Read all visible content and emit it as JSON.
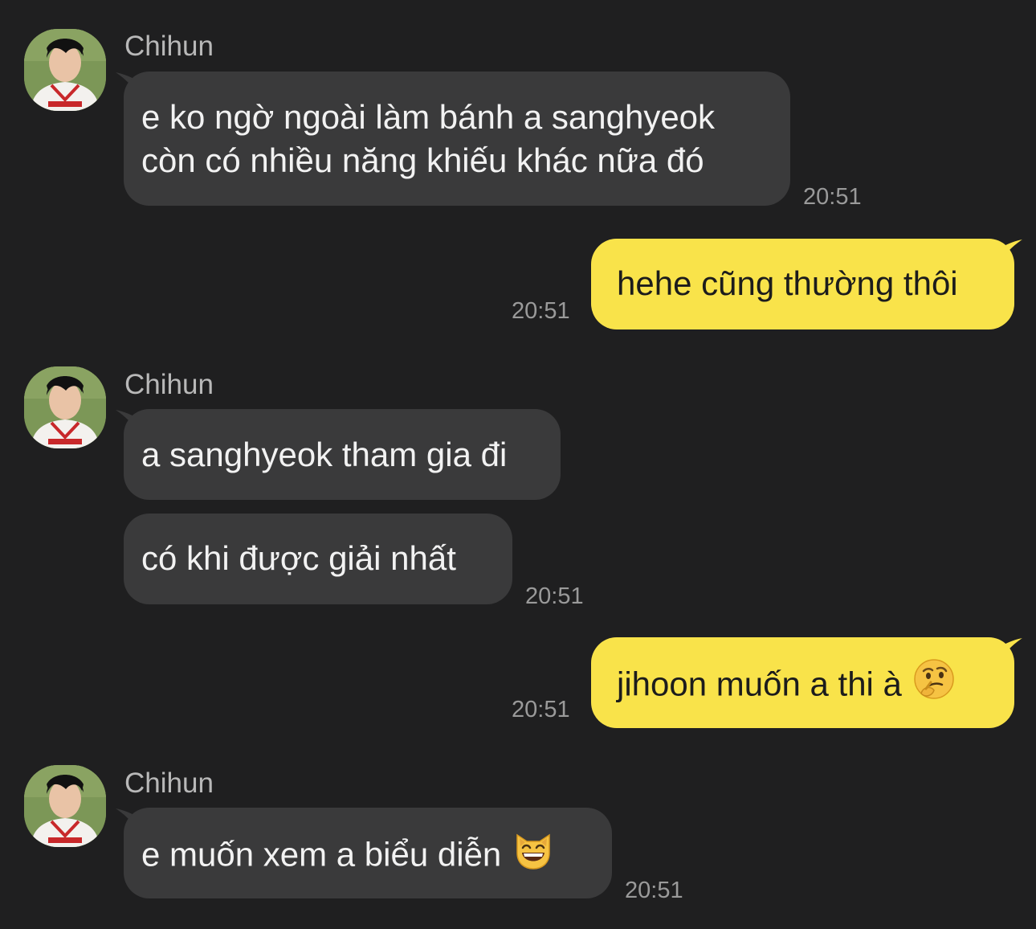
{
  "messages": [
    {
      "direction": "incoming",
      "sender": "Chihun",
      "lines": [
        "e ko ngờ ngoài làm bánh a sanghyeok",
        "còn có nhiều năng khiếu khác nữa đó"
      ],
      "time": "20:51"
    },
    {
      "direction": "outgoing",
      "text": "hehe cũng thường thôi",
      "time": "20:51"
    },
    {
      "direction": "incoming",
      "sender": "Chihun",
      "text": "a sanghyeok tham gia đi"
    },
    {
      "direction": "incoming",
      "text": "có khi được giải nhất",
      "time": "20:51"
    },
    {
      "direction": "outgoing",
      "text": "jihoon muốn a thi à",
      "emoji": "thinking-face",
      "time": "20:51"
    },
    {
      "direction": "incoming",
      "sender": "Chihun",
      "text": "e muốn xem a biểu diễn",
      "emoji": "grinning-cat",
      "time": "20:51"
    }
  ],
  "colors": {
    "background": "#1f1f20",
    "incoming_bubble": "#3a3a3b",
    "outgoing_bubble": "#f9e34a",
    "timestamp": "#9a9a9a",
    "sender_name": "#b8b8b8"
  }
}
